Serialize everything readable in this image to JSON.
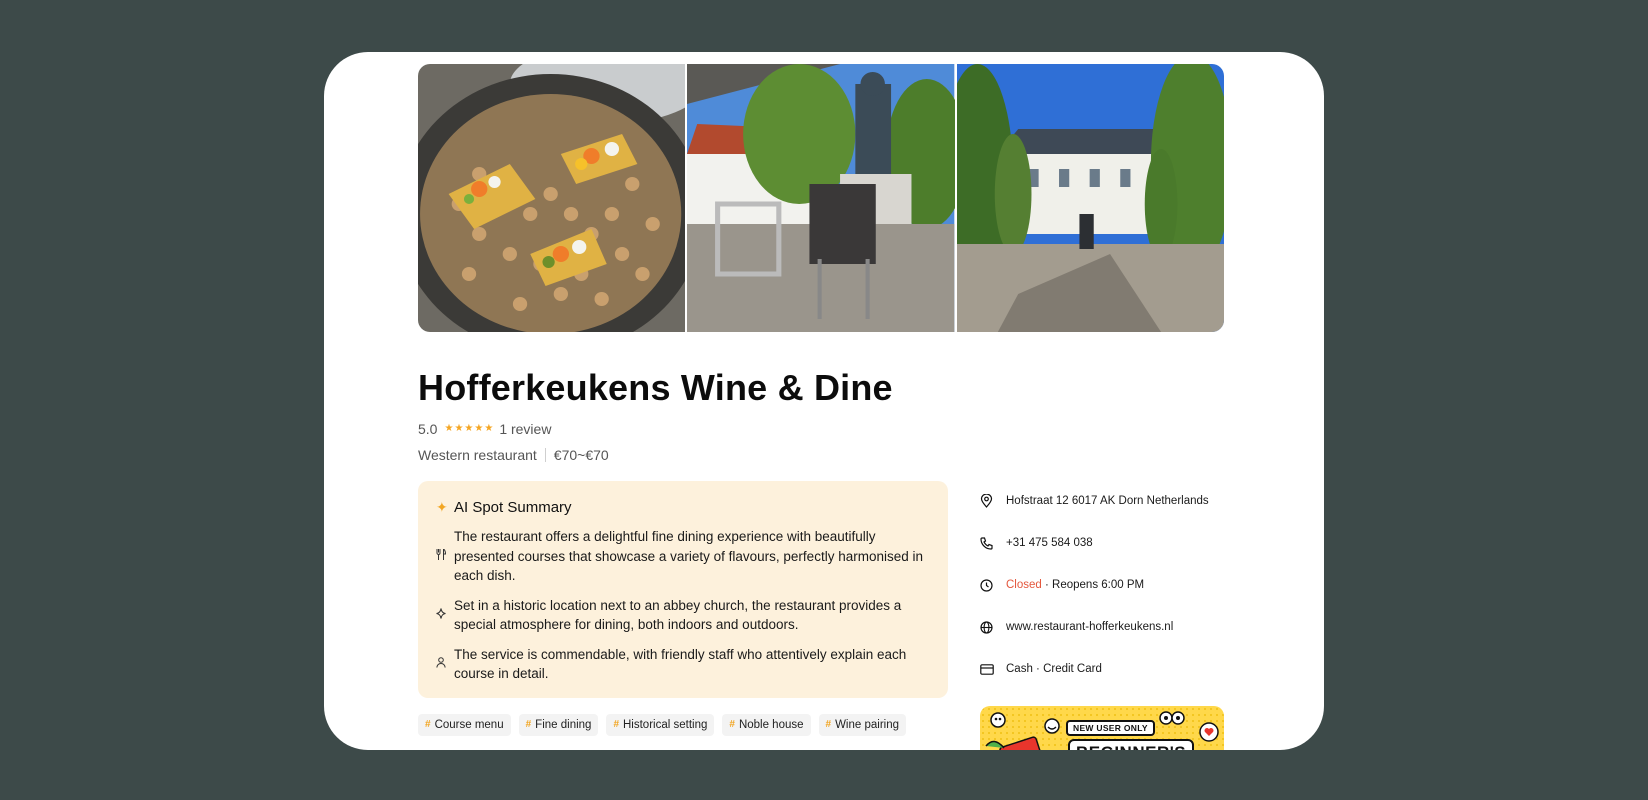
{
  "gallery": {
    "photos": [
      {
        "name": "food-photo",
        "alt": "chickpea dish"
      },
      {
        "name": "terrace-photo",
        "alt": "terrace with statue"
      },
      {
        "name": "building-photo",
        "alt": "historic building"
      }
    ]
  },
  "restaurant": {
    "name": "Hofferkeukens Wine & Dine",
    "rating": "5.0",
    "stars": 5,
    "reviews": "1 review",
    "category": "Western restaurant",
    "price": "€70~€70"
  },
  "ai_summary": {
    "heading": "AI Spot Summary",
    "items": [
      {
        "icon": "cutlery-icon",
        "text": "The restaurant offers a delightful fine dining experience with beautifully presented courses that showcase a variety of flavours, perfectly harmonised in each dish."
      },
      {
        "icon": "sparkle-icon",
        "text": "Set in a historic location next to an abbey church, the restaurant provides a special atmosphere for dining, both indoors and outdoors."
      },
      {
        "icon": "person-icon",
        "text": "The service is commendable, with friendly staff who attentively explain each course in detail."
      }
    ]
  },
  "tags": [
    "Course menu",
    "Fine dining",
    "Historical setting",
    "Noble house",
    "Wine pairing"
  ],
  "info": {
    "address": "Hofstraat 12 6017 AK Dorn Netherlands",
    "phone": "+31 475 584 038",
    "status": "Closed",
    "reopens": " · Reopens 6:00 PM",
    "website": "www.restaurant-hofferkeukens.nl",
    "payment": "Cash · Credit Card"
  },
  "promo": {
    "badge": "NEW USER ONLY",
    "headline": "BEGINNER'S"
  },
  "colors": {
    "background": "#3d4a49",
    "accent": "#f5a623",
    "summary_bg": "#fdf1dc",
    "closed": "#e4573d",
    "promo": "#ffd84a"
  }
}
